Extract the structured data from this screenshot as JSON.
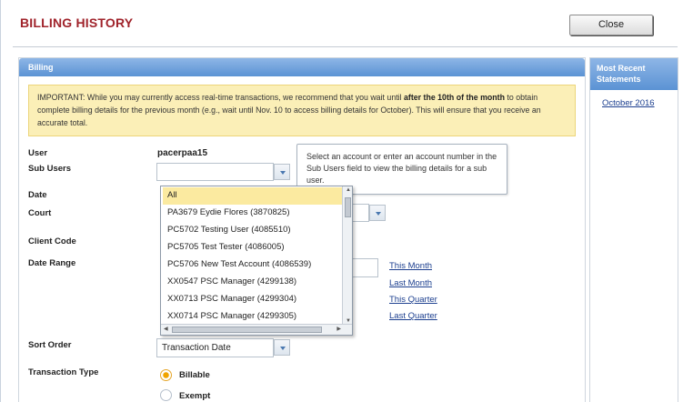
{
  "header": {
    "title": "BILLING HISTORY",
    "close_label": "Close"
  },
  "panel": {
    "title": "Billing",
    "notice_prefix": "IMPORTANT: While you may currently access real-time transactions, we recommend that you wait until ",
    "notice_bold": "after the 10th of the month",
    "notice_suffix": " to obtain complete billing details for the previous month (e.g., wait until Nov. 10 to access billing details for October). This will ensure that you receive an accurate total."
  },
  "form": {
    "user_label": "User",
    "user_value": "pacerpaa15",
    "sub_users_label": "Sub Users",
    "date_label": "Date",
    "court_label": "Court",
    "client_code_label": "Client Code",
    "date_range_label": "Date Range",
    "sort_order_label": "Sort Order",
    "sort_order_value": "Transaction Date",
    "transaction_type_label": "Transaction Type",
    "billable_label": "Billable",
    "exempt_label": "Exempt"
  },
  "tooltip": {
    "text": "Select an account or enter an account number in the Sub Users field to view the billing details for a sub user."
  },
  "dropdown": {
    "items": [
      "All",
      "PA3679 Eydie Flores (3870825)",
      "PC5702 Testing User (4085510)",
      "PC5705 Test Tester (4086005)",
      "PC5706 New Test Account (4086539)",
      "XX0547 PSC Manager (4299138)",
      "XX0713 PSC Manager (4299304)",
      "XX0714 PSC Manager (4299305)"
    ]
  },
  "date_links": {
    "this_month": "This Month",
    "last_month": "Last Month",
    "this_quarter": "This Quarter",
    "last_quarter": "Last Quarter"
  },
  "side": {
    "title": "Most Recent Statements",
    "link": "October 2016"
  },
  "colors": {
    "title": "#a0232b",
    "header_blue": "#5b93d4",
    "notice_bg": "#fbefb7",
    "selected_item": "#fbeaa0",
    "link": "#1c3f8f"
  }
}
